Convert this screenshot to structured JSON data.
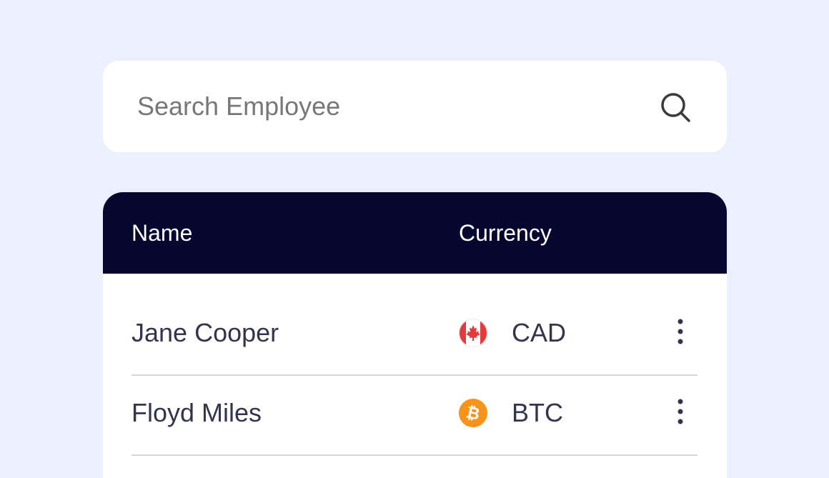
{
  "search": {
    "placeholder": "Search Employee",
    "icon": "search-icon"
  },
  "table": {
    "columns": [
      "Name",
      "Currency"
    ],
    "header_color": "#06062e",
    "rows": [
      {
        "name": "Jane Cooper",
        "currency": "CAD",
        "currency_icon": "canada-flag-icon"
      },
      {
        "name": "Floyd Miles",
        "currency": "BTC",
        "currency_icon": "bitcoin-icon"
      }
    ]
  },
  "colors": {
    "background": "#eceffd",
    "text": "#34354d",
    "bitcoin": "#f7931a",
    "canada_red": "#e63a3a"
  }
}
